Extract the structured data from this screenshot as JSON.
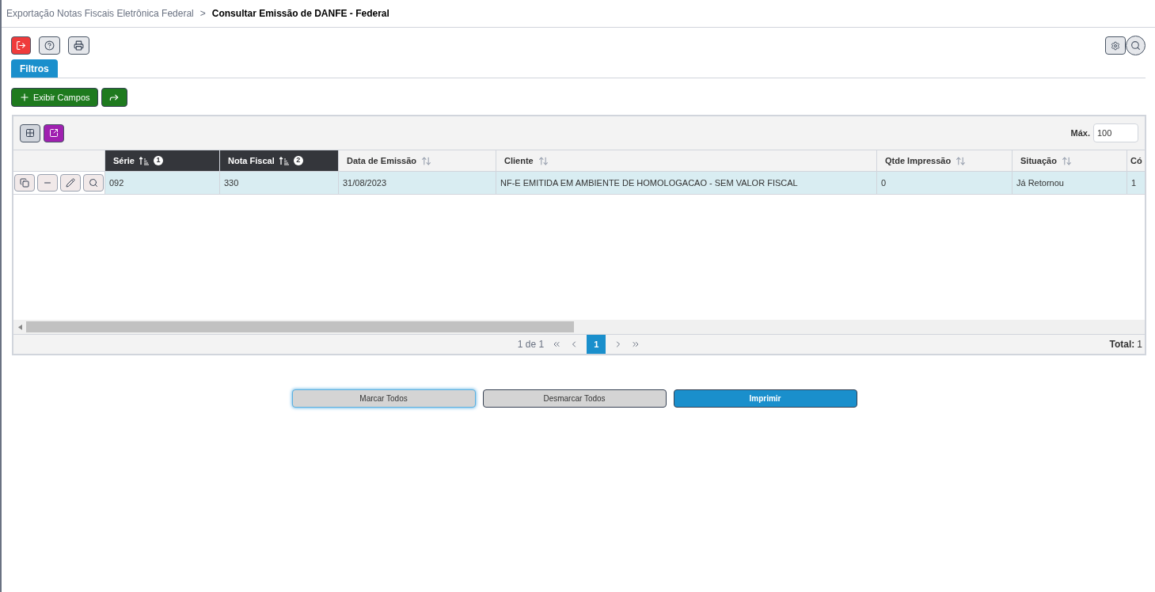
{
  "breadcrumb": {
    "parent": "Exportação Notas Fiscais Eletrônica Federal",
    "separator": ">",
    "current": "Consultar Emissão de DANFE - Federal"
  },
  "tabs": [
    {
      "label": "Filtros",
      "selected": true
    }
  ],
  "actions": [
    {
      "label": "Exibir Campos",
      "kind": "add"
    },
    {
      "kind": "share"
    }
  ],
  "grid": {
    "max_label": "Máx.",
    "max_value": "100",
    "columns": [
      {
        "label": "Série",
        "sorted": true,
        "sort_order": "1"
      },
      {
        "label": "Nota Fiscal",
        "sorted": true,
        "sort_order": "2"
      },
      {
        "label": "Data de Emissão",
        "sorted": false
      },
      {
        "label": "Cliente",
        "sorted": false
      },
      {
        "label": "Qtde Impressão",
        "sorted": false
      },
      {
        "label": "Situação",
        "sorted": false
      },
      {
        "label": "Có",
        "sorted": false
      }
    ],
    "rows": [
      {
        "selected": true,
        "cells": [
          "092",
          "330",
          "31/08/2023",
          "NF-E EMITIDA EM AMBIENTE DE HOMOLOGACAO - SEM VALOR FISCAL",
          "0",
          "Já Retornou",
          "1"
        ]
      }
    ],
    "pager": {
      "info": "1 de 1",
      "pages": [
        {
          "label": "1",
          "selected": true
        }
      ],
      "total_label": "Total:",
      "total": "1"
    }
  },
  "buttons": [
    {
      "label": "Marcar Todos",
      "kind": "default",
      "focused": true
    },
    {
      "label": "Desmarcar Todos",
      "kind": "default",
      "focused": false
    },
    {
      "label": "Imprimir",
      "kind": "primary",
      "focused": false
    }
  ]
}
